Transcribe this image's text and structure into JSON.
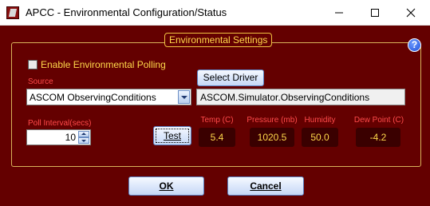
{
  "window": {
    "title": "APCC - Environmental Configuration/Status",
    "icon": "apcc-app-icon",
    "controls": [
      "minimize-icon",
      "maximize-icon",
      "close-icon"
    ]
  },
  "group": {
    "title": "Environmental Settings",
    "help_glyph": "?"
  },
  "polling": {
    "checkbox_label": "Enable Environmental Polling",
    "checked": false
  },
  "source": {
    "label": "Source",
    "selected": "ASCOM ObservingConditions",
    "select_driver_label": "Select Driver",
    "driver_name": "ASCOM.Simulator.ObservingConditions"
  },
  "poll_interval": {
    "label": "Poll Interval(secs)",
    "value": "10"
  },
  "test_button": {
    "label": "Test"
  },
  "readings": {
    "temp_label": "Temp (C)",
    "temp_value": "5.4",
    "pressure_label": "Pressure (mb)",
    "pressure_value": "1020.5",
    "humidity_label": "Humidity",
    "humidity_value": "50.0",
    "dewpoint_label": "Dew Point (C)",
    "dewpoint_value": "-4.2"
  },
  "footer": {
    "ok_label": "OK",
    "cancel_label": "Cancel"
  },
  "colors": {
    "background": "#640000",
    "accent_text": "#ffd84a",
    "label_red": "#ff4a4a",
    "readout_bg": "#3a0000",
    "button_border": "#5a7fc0"
  }
}
